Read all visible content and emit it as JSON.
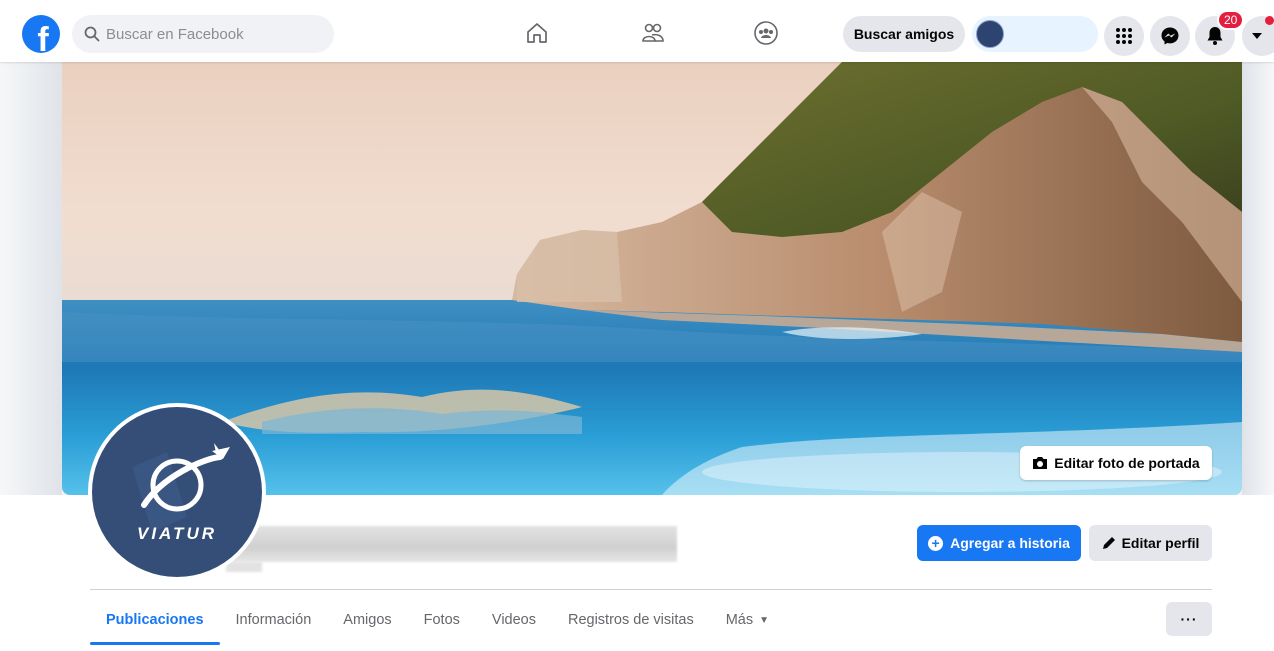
{
  "topbar": {
    "logo_letter": "f",
    "search_placeholder": "Buscar en Facebook",
    "nav_icons": [
      "home-icon",
      "friends-icon",
      "groups-icon"
    ],
    "find_friends_label": "Buscar amigos",
    "right_icons": [
      "menu-grid-icon",
      "messenger-icon",
      "notifications-icon",
      "account-caret-icon"
    ],
    "notification_count": "20"
  },
  "cover": {
    "edit_cover_label": "Editar foto de portada",
    "colors": {
      "sky": "#f0d9c8",
      "sea": "#2f8fc9",
      "cliff": "#c79a7a",
      "vegetation": "#5b6a2e"
    }
  },
  "profile": {
    "avatar_text": "VIATUR",
    "avatar_color": "#344e78"
  },
  "actions": {
    "add_story_label": "Agregar a historia",
    "edit_profile_label": "Editar perfil",
    "more_options_label": "···"
  },
  "tabs": [
    {
      "label": "Publicaciones",
      "active": true
    },
    {
      "label": "Información",
      "active": false
    },
    {
      "label": "Amigos",
      "active": false
    },
    {
      "label": "Fotos",
      "active": false
    },
    {
      "label": "Videos",
      "active": false
    },
    {
      "label": "Registros de visitas",
      "active": false
    },
    {
      "label": "Más",
      "active": false
    }
  ],
  "accent_color": "#1877f2"
}
